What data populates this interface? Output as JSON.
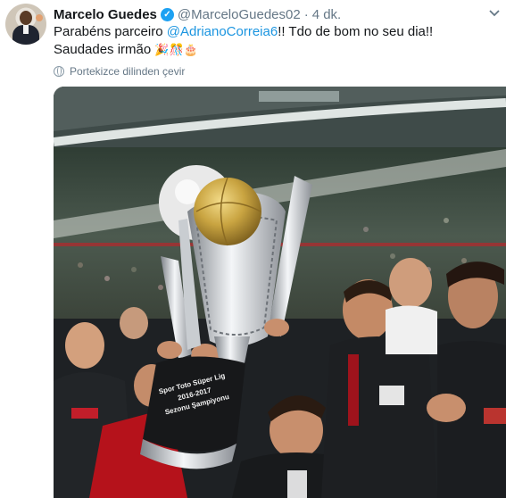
{
  "tweet": {
    "author_name": "Marcelo Guedes",
    "author_handle": "@MarceloGuedes02",
    "separator": "·",
    "timestamp": "4 dk.",
    "text_before": "Parabéns parceiro ",
    "mention": "@AdrianoCorreia6",
    "text_after": "!! Tdo de bom no seu dia!! Saudades irmão ",
    "emojis": "🎉🎊🎂",
    "translate_label": "Portekizce dilinden çevir",
    "trophy_plaque": "Spor Toto Süper Lig 2016-2017 Sezonu Şampiyonu"
  },
  "icons": {
    "verified": "verified-badge-icon",
    "more": "chevron-down-icon",
    "translate": "globe-icon"
  },
  "colors": {
    "link": "#1b95e0",
    "verified": "#1da1f2",
    "secondary_text": "#657786"
  }
}
